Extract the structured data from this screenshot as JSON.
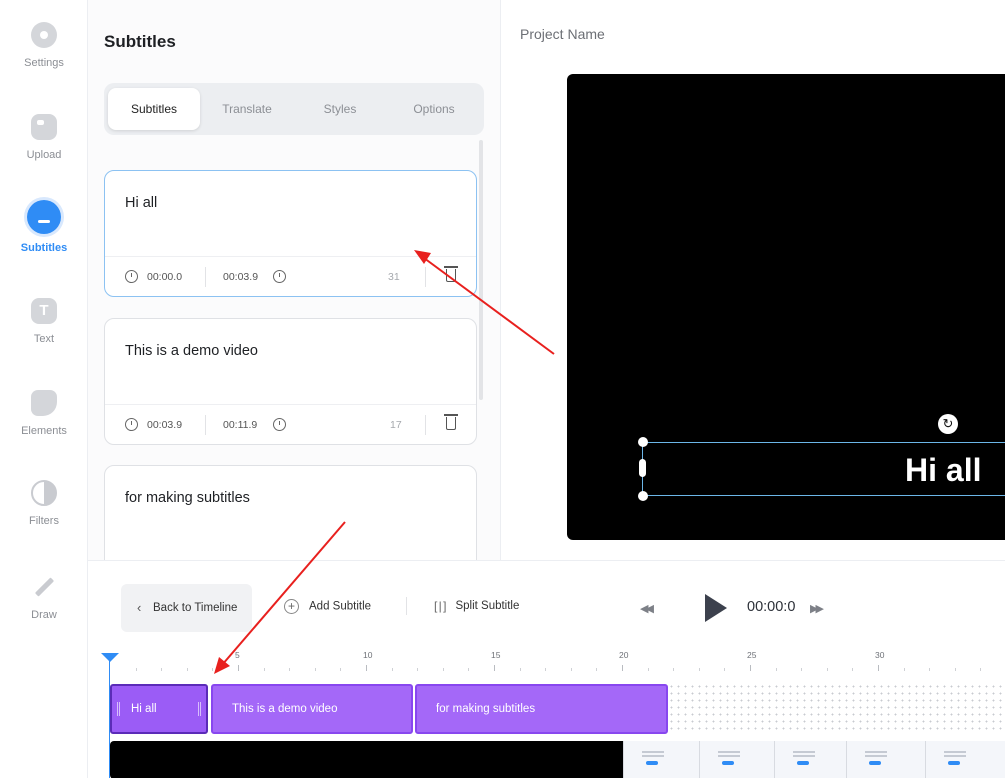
{
  "sidebar": {
    "items": [
      {
        "label": "Settings",
        "icon": "gear-icon"
      },
      {
        "label": "Upload",
        "icon": "upload-icon"
      },
      {
        "label": "Subtitles",
        "icon": "subtitles-icon",
        "active": true
      },
      {
        "label": "Text",
        "icon": "text-icon"
      },
      {
        "label": "Elements",
        "icon": "elements-icon"
      },
      {
        "label": "Filters",
        "icon": "filters-icon"
      },
      {
        "label": "Draw",
        "icon": "pencil-icon"
      }
    ]
  },
  "panel": {
    "title": "Subtitles",
    "tabs": [
      {
        "label": "Subtitles",
        "active": true
      },
      {
        "label": "Translate"
      },
      {
        "label": "Styles"
      },
      {
        "label": "Options"
      }
    ],
    "cards": [
      {
        "text": "Hi all",
        "start": "00:00.0",
        "end": "00:03.9",
        "count": "31"
      },
      {
        "text": "This is a demo video",
        "start": "00:03.9",
        "end": "00:11.9",
        "count": "17"
      },
      {
        "text": "for making subtitles"
      }
    ]
  },
  "preview": {
    "project_name": "Project Name",
    "overlay_text": "Hi all"
  },
  "timeline": {
    "back_label": "Back to Timeline",
    "add_label": "Add Subtitle",
    "split_label": "Split Subtitle",
    "timecode": "00:00:0",
    "ruler_labels": [
      "5",
      "10",
      "15",
      "20",
      "25",
      "30"
    ],
    "segments": [
      {
        "label": "Hi all"
      },
      {
        "label": "This is a demo video"
      },
      {
        "label": "for making subtitles"
      }
    ]
  },
  "colors": {
    "accent": "#2f8cf5",
    "segment": "#a468f8",
    "annotation_arrow": "#e8201e"
  }
}
